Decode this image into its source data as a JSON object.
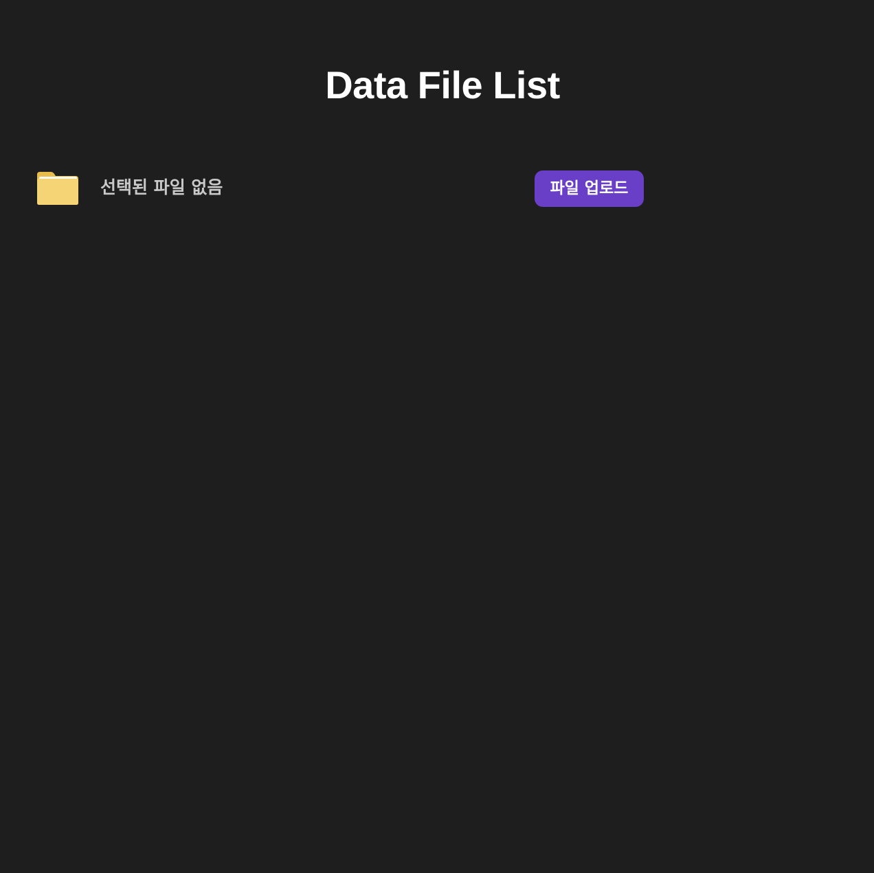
{
  "page": {
    "title": "Data File List"
  },
  "file_picker": {
    "icon": "folder-icon",
    "status_text": "선택된 파일 없음",
    "upload_label": "파일 업로드"
  },
  "colors": {
    "background": "#1e1e1e",
    "accent": "#6a3fc8",
    "folder": "#f4d475",
    "status_text": "#c9c9c9"
  }
}
